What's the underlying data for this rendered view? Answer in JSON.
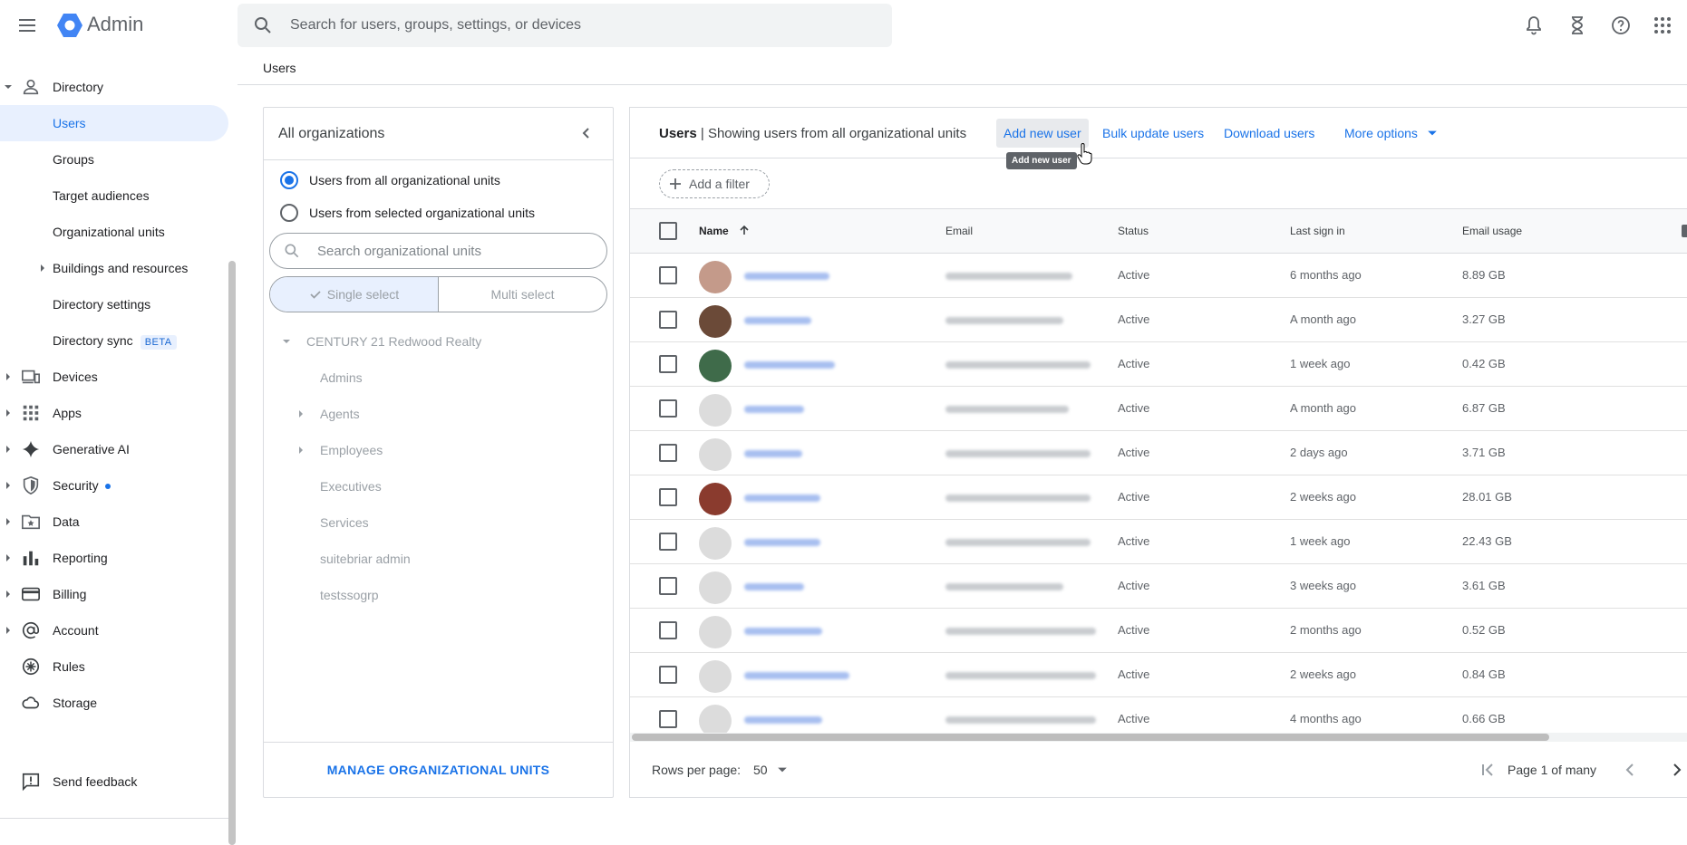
{
  "app": {
    "title": "Admin"
  },
  "search": {
    "placeholder": "Search for users, groups, settings, or devices"
  },
  "breadcrumb": "Users",
  "sidebar": {
    "items": [
      {
        "label": "Directory",
        "icon": "person-icon",
        "expanded": true
      },
      {
        "label": "Users",
        "active": true
      },
      {
        "label": "Groups"
      },
      {
        "label": "Target audiences"
      },
      {
        "label": "Organizational units"
      },
      {
        "label": "Buildings and resources"
      },
      {
        "label": "Directory settings"
      },
      {
        "label": "Directory sync",
        "badge": "BETA"
      },
      {
        "label": "Devices",
        "icon": "devices-icon"
      },
      {
        "label": "Apps",
        "icon": "apps-grid-icon"
      },
      {
        "label": "Generative AI",
        "icon": "sparkle-icon"
      },
      {
        "label": "Security",
        "icon": "shield-icon"
      },
      {
        "label": "Data",
        "icon": "data-folder-icon"
      },
      {
        "label": "Reporting",
        "icon": "bar-chart-icon"
      },
      {
        "label": "Billing",
        "icon": "credit-card-icon"
      },
      {
        "label": "Account",
        "icon": "at-sign-icon"
      },
      {
        "label": "Rules",
        "icon": "rules-icon"
      },
      {
        "label": "Storage",
        "icon": "cloud-icon"
      }
    ],
    "feedback": "Send feedback"
  },
  "orgs": {
    "title": "All organizations",
    "radio_all": "Users from all organizational units",
    "radio_selected": "Users from selected organizational units",
    "search_placeholder": "Search organizational units",
    "single": "Single select",
    "multi": "Multi select",
    "root": "CENTURY 21 Redwood Realty",
    "children": [
      "Admins",
      "Agents",
      "Employees",
      "Executives",
      "Services",
      "suitebriar admin",
      "testssogrp"
    ],
    "manage": "MANAGE ORGANIZATIONAL UNITS"
  },
  "users": {
    "title": "Users",
    "subtitle": "| Showing users from all organizational units",
    "add": "Add new user",
    "bulk": "Bulk update users",
    "download": "Download users",
    "more": "More options",
    "tooltip": "Add new user",
    "add_filter": "Add a filter",
    "columns": {
      "name": "Name",
      "email": "Email",
      "status": "Status",
      "last": "Last sign in",
      "usage": "Email usage"
    },
    "rows": [
      {
        "status": "Active",
        "last": "6 months ago",
        "usage": "8.89 GB"
      },
      {
        "status": "Active",
        "last": "A month ago",
        "usage": "3.27 GB"
      },
      {
        "status": "Active",
        "last": "1 week ago",
        "usage": "0.42 GB"
      },
      {
        "status": "Active",
        "last": "A month ago",
        "usage": "6.87 GB"
      },
      {
        "status": "Active",
        "last": "2 days ago",
        "usage": "3.71 GB"
      },
      {
        "status": "Active",
        "last": "2 weeks ago",
        "usage": "28.01 GB"
      },
      {
        "status": "Active",
        "last": "1 week ago",
        "usage": "22.43 GB"
      },
      {
        "status": "Active",
        "last": "3 weeks ago",
        "usage": "3.61 GB"
      },
      {
        "status": "Active",
        "last": "2 months ago",
        "usage": "0.52 GB"
      },
      {
        "status": "Active",
        "last": "2 weeks ago",
        "usage": "0.84 GB"
      },
      {
        "status": "Active",
        "last": "4 months ago",
        "usage": "0.66 GB"
      }
    ],
    "rows_per_page_label": "Rows per page:",
    "rows_per_page": "50",
    "page_label": "Page 1 of many"
  },
  "colors": {
    "accent": "#1a73e8",
    "active_bg": "#e8f0fe"
  }
}
